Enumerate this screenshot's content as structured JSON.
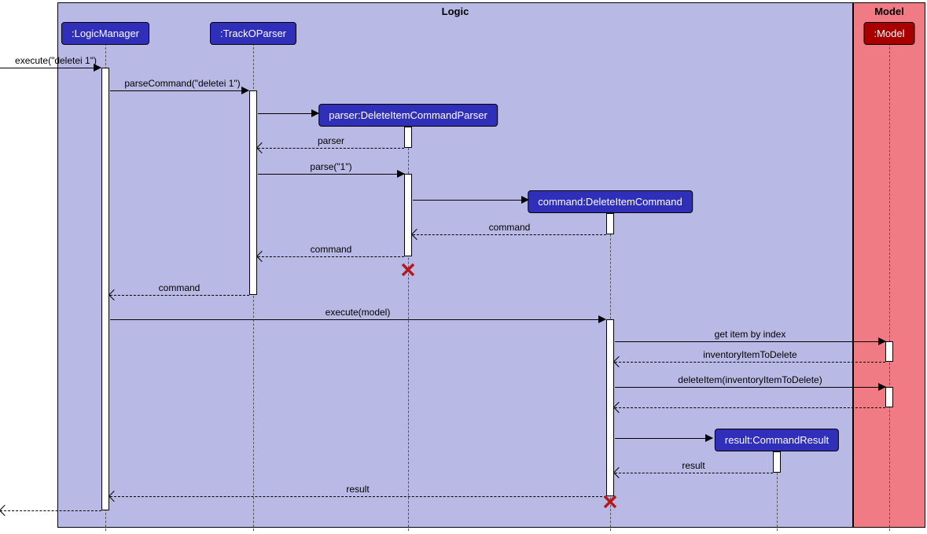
{
  "frames": {
    "logic": "Logic",
    "model": "Model"
  },
  "participants": {
    "logicManager": ":LogicManager",
    "trackOParser": ":TrackOParser",
    "deleteItemCommandParser": "parser:DeleteItemCommandParser",
    "deleteItemCommand": "command:DeleteItemCommand",
    "commandResult": "result:CommandResult",
    "model": ":Model"
  },
  "messages": {
    "m1": "execute(\"deletei 1\")",
    "m2": "parseCommand(\"deletei 1\")",
    "m3_return": "parser",
    "m4": "parse(\"1\")",
    "m5_return": "command",
    "m6_return": "command",
    "m7_return": "command",
    "m8": "execute(model)",
    "m9": "get item by index",
    "m10_return": "inventoryItemToDelete",
    "m11": "deleteItem(inventoryItemToDelete)",
    "m12_return": "result",
    "m13_return": "result"
  },
  "glyph": {
    "destroy": "✕"
  }
}
